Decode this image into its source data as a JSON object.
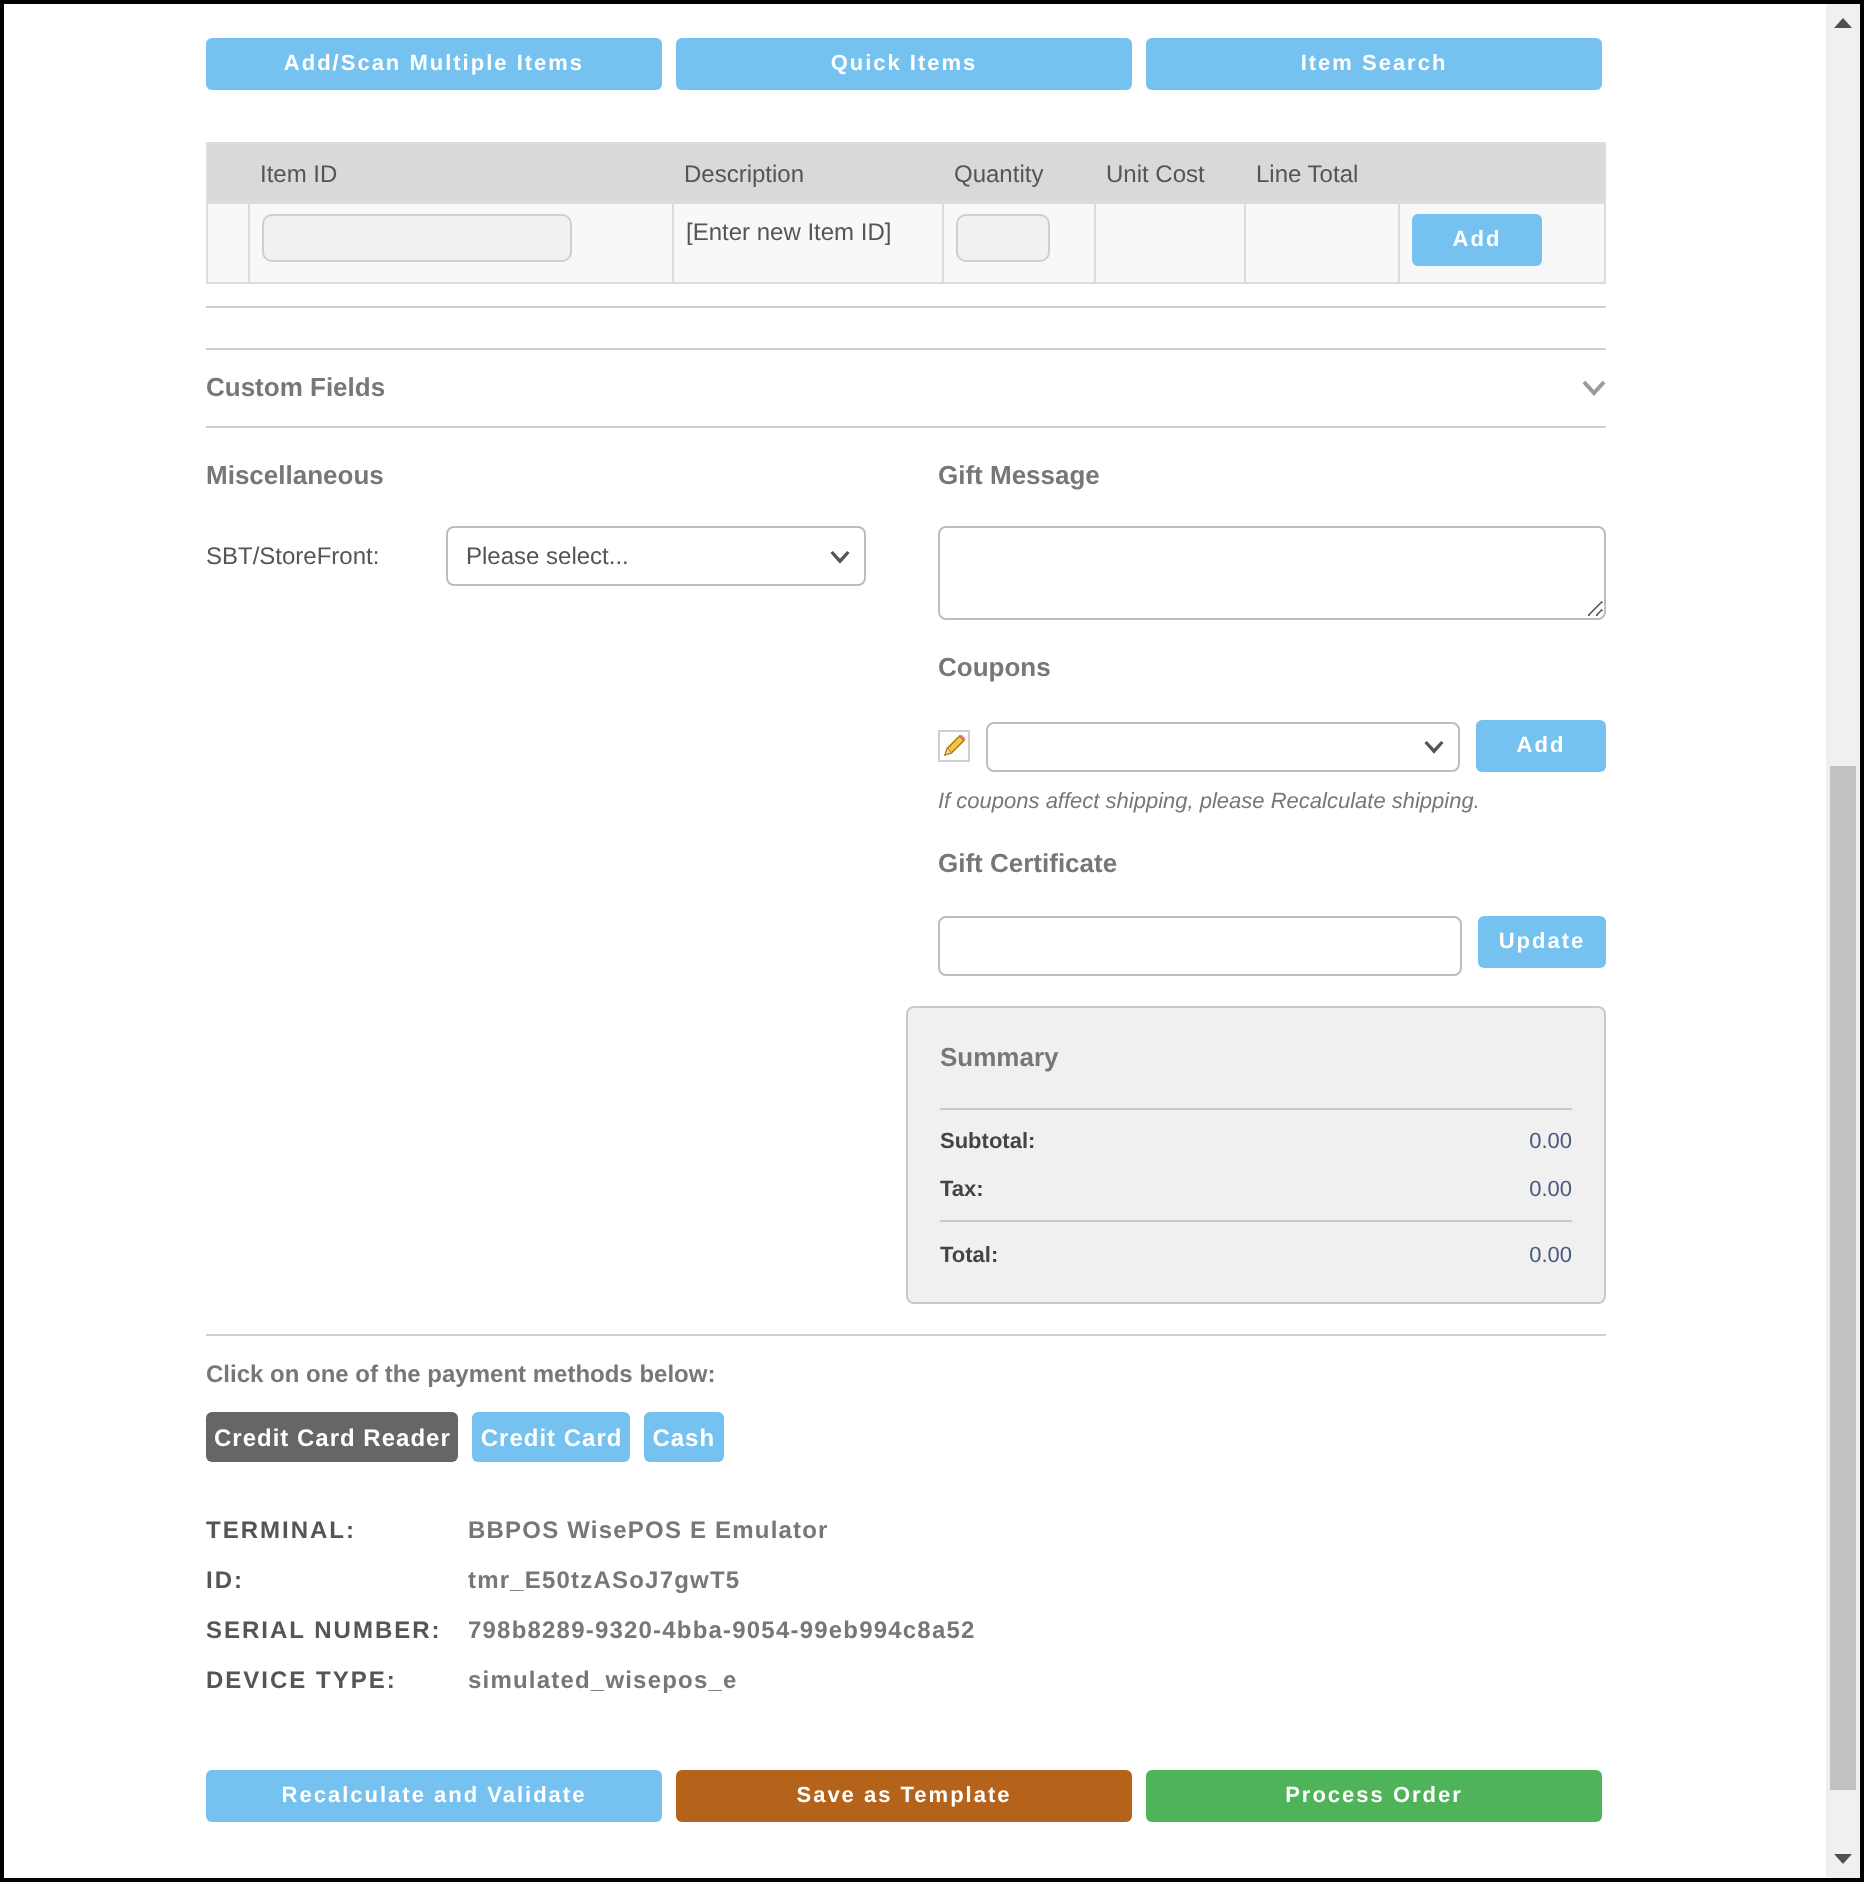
{
  "item_buttons": [
    "Add/Scan Multiple Items",
    "Quick Items",
    "Item Search"
  ],
  "items_table": {
    "columns": [
      "Item ID",
      "Description",
      "Quantity",
      "Unit Cost",
      "Line Total"
    ],
    "new_row": {
      "description": "[Enter new Item ID]",
      "button": "Add"
    }
  },
  "custom_fields": {
    "title": "Custom Fields",
    "expanded": false
  },
  "miscellaneous": {
    "title": "Miscellaneous",
    "fields": [
      {
        "label": "SBT/StoreFront:",
        "value": "Please select..."
      }
    ]
  },
  "gift_message": {
    "title": "Gift Message"
  },
  "coupons": {
    "title": "Coupons",
    "button": "Add",
    "note": "If coupons affect shipping, please Recalculate shipping."
  },
  "gift_certificate": {
    "title": "Gift Certificate",
    "button": "Update"
  },
  "summary": {
    "title": "Summary",
    "rows": [
      {
        "label": "Subtotal:",
        "value": "0.00"
      },
      {
        "label": "Tax:",
        "value": "0.00"
      }
    ],
    "total": {
      "label": "Total:",
      "value": "0.00"
    }
  },
  "payment": {
    "prompt": "Click on one of the payment methods below:",
    "methods": [
      {
        "label": "Credit Card Reader",
        "selected": true
      },
      {
        "label": "Credit Card",
        "selected": false
      },
      {
        "label": "Cash",
        "selected": false
      }
    ]
  },
  "terminal": [
    {
      "label": "TERMINAL:",
      "value": "BBPOS WisePOS E Emulator"
    },
    {
      "label": "ID:",
      "value": "tmr_E50tzASoJ7gwT5"
    },
    {
      "label": "SERIAL NUMBER:",
      "value": "798b8289-9320-4bba-9054-99eb994c8a52"
    },
    {
      "label": "DEVICE TYPE:",
      "value": "simulated_wisepos_e"
    }
  ],
  "actions": [
    {
      "label": "Recalculate and Validate",
      "color": "#75c1ef"
    },
    {
      "label": "Save as Template",
      "color": "#b5621a"
    },
    {
      "label": "Process Order",
      "color": "#4fb35a"
    }
  ]
}
